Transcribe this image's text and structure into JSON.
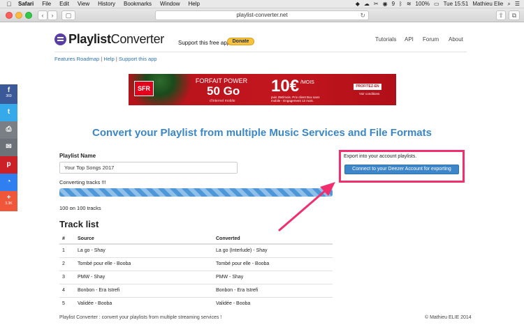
{
  "menubar": {
    "app": "Safari",
    "items": [
      "File",
      "Edit",
      "View",
      "History",
      "Bookmarks",
      "Window",
      "Help"
    ],
    "battery": "100%",
    "clock": "Tue 15:51",
    "user": "Mathieu Elie",
    "notification_count": "9"
  },
  "browser": {
    "url": "playlist-converter.net",
    "back_glyph": "‹",
    "forward_glyph": "›"
  },
  "site": {
    "logo_bold": "Playlist",
    "logo_regular": "Converter",
    "support_text": "Support this free app",
    "donate_label": "Donate",
    "nav": [
      "Tutorials",
      "API",
      "Forum",
      "About"
    ],
    "sublinks": [
      "Features Roadmap",
      "Help",
      "Support this app"
    ],
    "sublink_separator": "|"
  },
  "ad": {
    "brand": "SFR",
    "line1": "FORFAIT POWER",
    "line2": "50 Go",
    "line3": "d'internet mobile",
    "price": "10€",
    "per": "/MOIS",
    "fine_print": "puis 25€/mois. Prix client Box sans mobile - Engagement 12 mois.",
    "cta": "PROFITEZ-EN",
    "conditions": "Voir conditions"
  },
  "share": {
    "facebook_count": "369",
    "more_count": "3.3K"
  },
  "main": {
    "title": "Convert your Playlist from multiple Music Services and File Formats",
    "playlist_label": "Playlist Name",
    "playlist_value": "Your Top Songs 2017",
    "status": "Converting tracks !!!",
    "progress_fraction": 1.0,
    "count_text": "100 on 100 tracks",
    "tracklist_title": "Track list",
    "columns": [
      "#",
      "Source",
      "Converted"
    ],
    "rows": [
      [
        "1",
        "La go - Shay",
        "La go (Interlude) - Shay"
      ],
      [
        "2",
        "Tombé pour elle - Booba",
        "Tombé pour elle - Booba"
      ],
      [
        "3",
        "PMW - Shay",
        "PMW - Shay"
      ],
      [
        "4",
        "Bonbon - Era Istrefi",
        "Bonbon - Era Istrefi"
      ],
      [
        "5",
        "Validée - Booba",
        "Validée - Booba"
      ]
    ]
  },
  "export": {
    "text": "Export into your account playlists.",
    "button": "Connect to your Deezer Account for exporting"
  },
  "footer": {
    "left": "Playlist Converter : convert your playlists from multiple streaming services !",
    "right": "© Mathieu ELIE 2014"
  },
  "colors": {
    "accent": "#3b86c6",
    "highlight": "#f12f6f",
    "donate": "#f7c33b"
  }
}
